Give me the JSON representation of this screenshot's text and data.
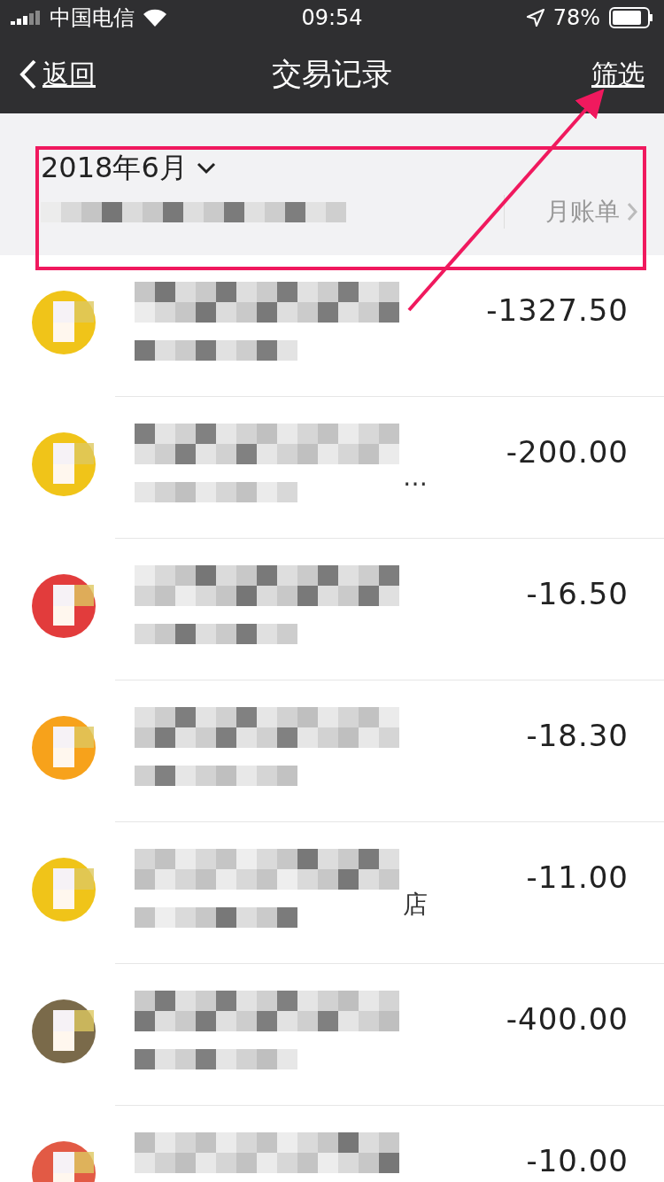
{
  "status_bar": {
    "carrier": "中国电信",
    "time": "09:54",
    "battery": "78%"
  },
  "nav": {
    "back": "返回",
    "title": "交易记录",
    "action": "筛选"
  },
  "month": {
    "label": "2018年6月",
    "bill_link": "月账单"
  },
  "transactions": [
    {
      "amount": "-1327.50",
      "color": "#f0c419"
    },
    {
      "amount": "-200.00",
      "color": "#f0c419",
      "note": "…"
    },
    {
      "amount": "-16.50",
      "color": "#e23c3c"
    },
    {
      "amount": "-18.30",
      "color": "#f7a21b"
    },
    {
      "amount": "-11.00",
      "color": "#f0c419",
      "note": "店"
    },
    {
      "amount": "-400.00",
      "color": "#7a6a4a"
    },
    {
      "amount": "-10.00",
      "color": "#e25a45"
    }
  ]
}
